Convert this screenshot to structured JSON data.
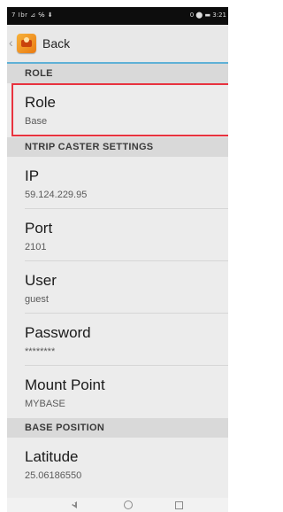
{
  "status_bar": {
    "left_text": "7 Ibr ⊿ ℅ ⬇",
    "right_text": "0 ⬤ ▬ 3:21"
  },
  "app_bar": {
    "back_label": "Back"
  },
  "sections": {
    "role": "ROLE",
    "ntrip": "NTRIP CASTER SETTINGS",
    "base_position": "BASE POSITION"
  },
  "items": {
    "role": {
      "title": "Role",
      "value": "Base"
    },
    "ip": {
      "title": "IP",
      "value": "59.124.229.95"
    },
    "port": {
      "title": "Port",
      "value": "2101"
    },
    "user": {
      "title": "User",
      "value": "guest"
    },
    "password": {
      "title": "Password",
      "value": "********"
    },
    "mount_point": {
      "title": "Mount Point",
      "value": "MYBASE"
    },
    "latitude": {
      "title": "Latitude",
      "value": "25.06186550"
    }
  },
  "colors": {
    "highlight": "#e8333f",
    "accent": "#5fb0d6",
    "app_icon": "#f0902a"
  },
  "icons": [
    "back-chevron-icon",
    "app-icon",
    "nav-back-icon",
    "nav-home-icon",
    "nav-recents-icon"
  ]
}
